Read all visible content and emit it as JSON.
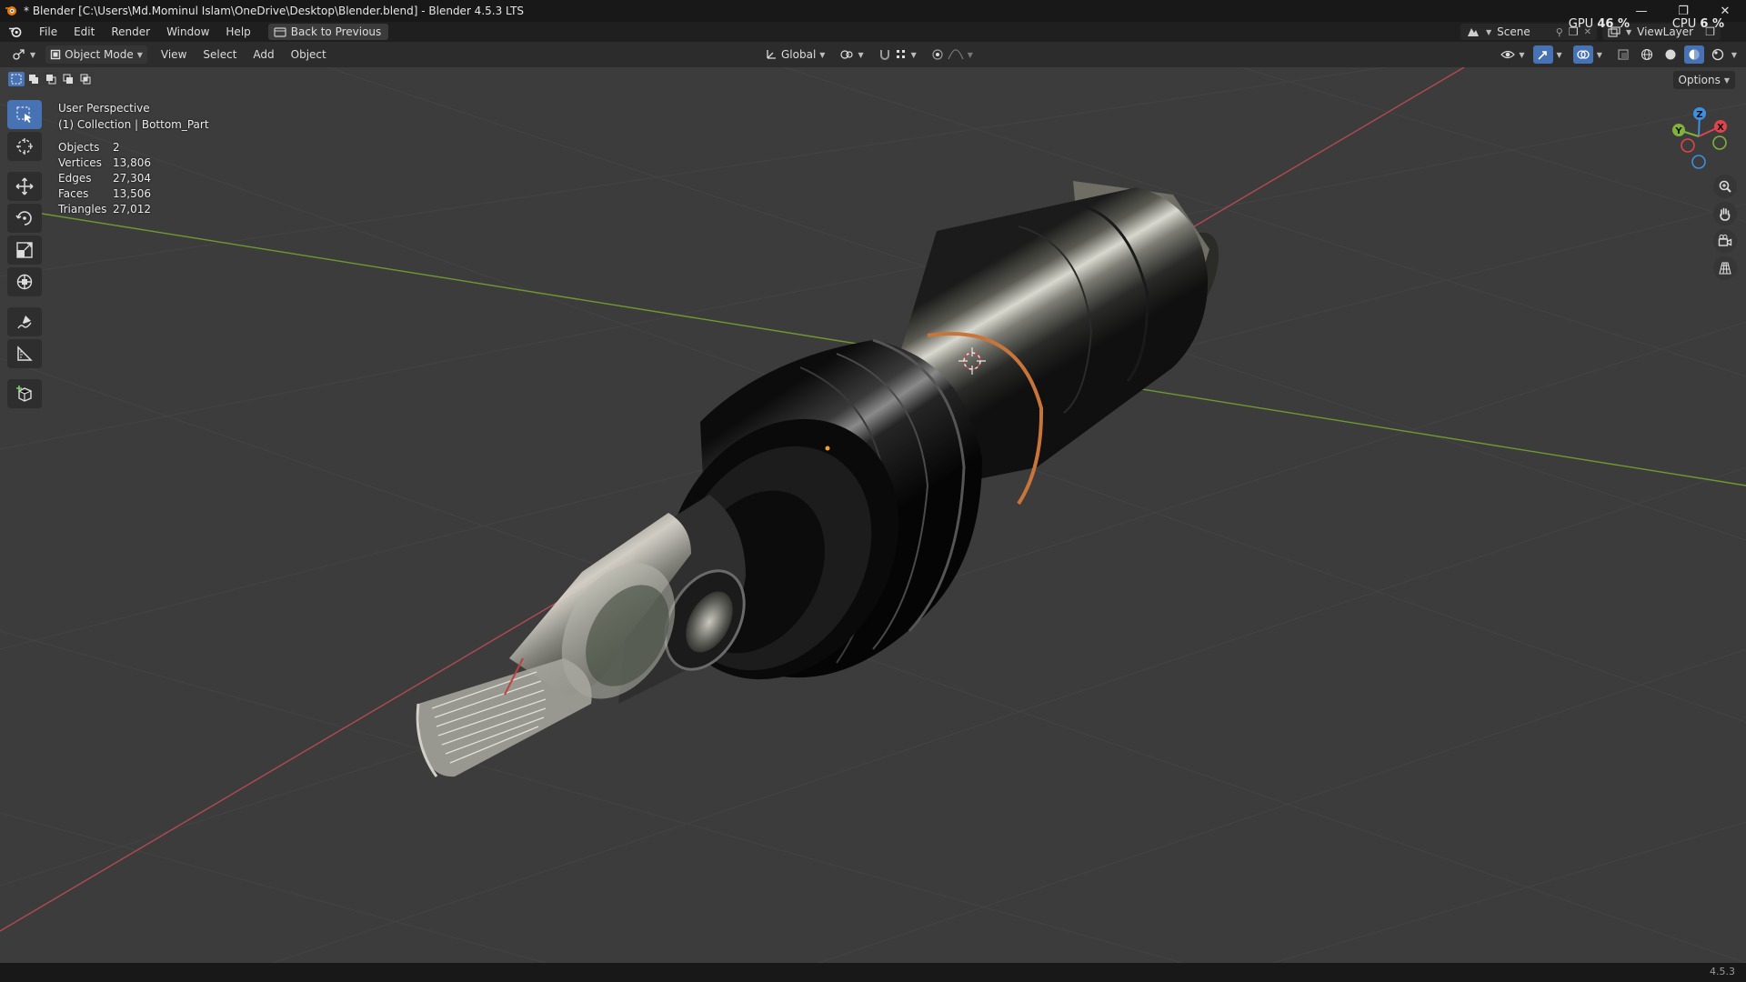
{
  "window": {
    "title": "* Blender [C:\\Users\\Md.Mominul Islam\\OneDrive\\Desktop\\Blender.blend] - Blender 4.5.3 LTS",
    "minimize": "—",
    "maximize": "❐",
    "close": "✕"
  },
  "menu": {
    "items": [
      "File",
      "Edit",
      "Render",
      "Window",
      "Help"
    ],
    "back_label": "Back to Previous",
    "scene_label": "Scene",
    "viewlayer_label": "ViewLayer"
  },
  "performance": {
    "gpu_label": "GPU",
    "gpu_value": "46 %",
    "cpu_label": "CPU",
    "cpu_value": "6 %"
  },
  "viewport_header": {
    "mode": "Object Mode",
    "menus": [
      "View",
      "Select",
      "Add",
      "Object"
    ],
    "orientation": "Global",
    "options_label": "Options"
  },
  "overlay": {
    "perspective": "User Perspective",
    "collection": "(1) Collection | Bottom_Part",
    "stats": [
      {
        "k": "Objects",
        "v": "2"
      },
      {
        "k": "Vertices",
        "v": "13,806"
      },
      {
        "k": "Edges",
        "v": "27,304"
      },
      {
        "k": "Faces",
        "v": "13,506"
      },
      {
        "k": "Triangles",
        "v": "27,012"
      }
    ]
  },
  "gizmo": {
    "x": "X",
    "y": "Y",
    "z": "Z",
    "colors": {
      "x": "#e0434e",
      "y": "#7fb33a",
      "z": "#3f8fe0"
    }
  },
  "status": {
    "version": "4.5.3"
  },
  "colors": {
    "accent": "#4772b3",
    "copper": "#c8753a"
  }
}
